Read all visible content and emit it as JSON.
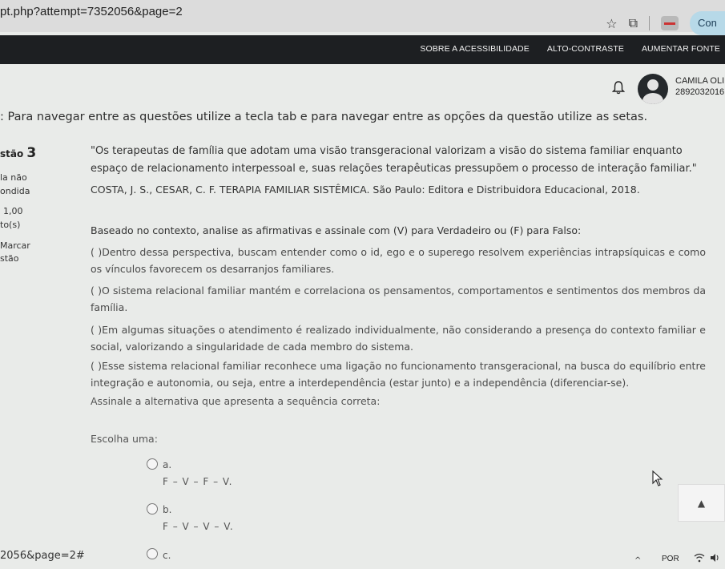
{
  "browser": {
    "url": "pt.php?attempt=7352056&page=2",
    "profile_label": "Con",
    "icons": [
      "star-icon",
      "extension-icon",
      "extension-badge-icon"
    ]
  },
  "accessibility_bar": {
    "links": [
      "SOBRE A ACESSIBILIDADE",
      "ALTO-CONTRASTE",
      "AUMENTAR FONTE"
    ]
  },
  "user": {
    "name": "CAMILA OLI",
    "id": "2892032016"
  },
  "instruction": ": Para navegar entre as questões utilize a tecla tab e para navegar entre as opções da questão utilize as setas.",
  "question_info": {
    "title_prefix": "stão",
    "number": "3",
    "status_1": "la não",
    "status_2": "ondida",
    "points": "1,00",
    "points_suffix": "to(s)",
    "flag_1": "Marcar",
    "flag_2": "stão"
  },
  "question": {
    "quote_line1": "\"Os terapeutas de família que adotam uma visão transgeracional valorizam a visão do sistema familiar enquanto",
    "quote_line2": "espaço de relacionamento interpessoal e, suas relações terapêuticas pressupõem o processo de interação familiar.\"",
    "citation": "COSTA, J. S., CESAR, C. F. TERAPIA FAMILIAR SISTÊMICA. São Paulo: Editora e Distribuidora Educacional, 2018.",
    "prompt": "Baseado no contexto, analise as afirmativas e assinale com (V) para Verdadeiro ou (F) para Falso:",
    "statements": [
      "( )Dentro dessa perspectiva, buscam entender como o id, ego e o superego resolvem experiências intrapsíquicas e como os vínculos favorecem os desarranjos familiares.",
      "( )O sistema relacional familiar mantém e correlaciona os pensamentos, comportamentos e sentimentos dos membros da família.",
      "( )Em algumas situações o atendimento é realizado individualmente, não considerando a presença do contexto familiar e social, valorizando a singularidade de cada membro do sistema.",
      "( )Esse sistema relacional familiar reconhece uma ligação no funcionamento transgeracional, na busca do equilíbrio entre integração e autonomia, ou seja, entre a interdependência (estar junto) e a independência (diferenciar-se)."
    ],
    "assinale": "Assinale a alternativa que apresenta a sequência correta:",
    "choose": "Escolha uma:",
    "options": [
      {
        "letter": "a.",
        "value": "F – V – F – V."
      },
      {
        "letter": "b.",
        "value": "F – V – V – V."
      },
      {
        "letter": "c.",
        "value": ""
      }
    ]
  },
  "status_url": "2056&page=2#",
  "taskbar": {
    "language": "POR"
  }
}
